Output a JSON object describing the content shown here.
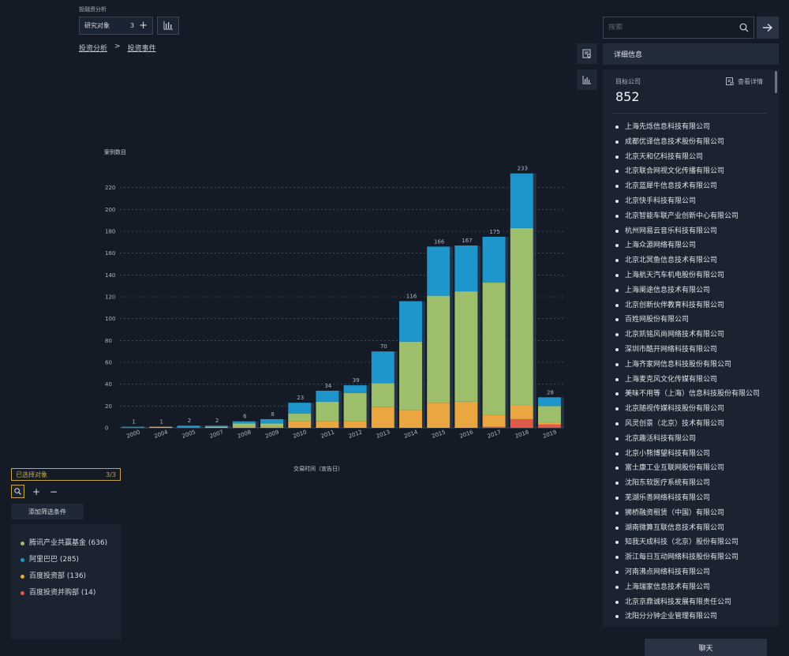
{
  "header": {
    "app_title": "投融资分析",
    "research_label": "研究对象",
    "research_count": "3",
    "plus": "+"
  },
  "breadcrumb": {
    "items": [
      "投资分析",
      "投资事件"
    ],
    "separator": ">"
  },
  "chart_data": {
    "type": "bar",
    "stacked": true,
    "ylabel": "案例数目",
    "xlabel": "交易时间（宣告日）",
    "ylim": [
      0,
      240
    ],
    "yticks": [
      0,
      20,
      40,
      60,
      80,
      100,
      120,
      140,
      160,
      180,
      200,
      220
    ],
    "grid": true,
    "categories": [
      "2000",
      "2004",
      "2005",
      "2007",
      "2008",
      "2009",
      "2010",
      "2011",
      "2012",
      "2013",
      "2014",
      "2015",
      "2016",
      "2017",
      "2018",
      "2019"
    ],
    "totals": [
      1,
      1,
      2,
      2,
      6,
      8,
      23,
      34,
      39,
      70,
      116,
      166,
      167,
      175,
      233,
      28
    ],
    "series": [
      {
        "name": "百度投资并购部",
        "color": "#e05a4a",
        "values": [
          0,
          0,
          0,
          0,
          0,
          0,
          0,
          0,
          0,
          0,
          0,
          0,
          0,
          1,
          8,
          3
        ]
      },
      {
        "name": "百度投资部",
        "color": "#eaa640",
        "values": [
          0,
          1,
          0,
          1,
          1,
          1,
          6,
          6,
          6,
          19,
          16,
          23,
          24,
          11,
          13,
          2
        ]
      },
      {
        "name": "腾讯产业共赢基金",
        "color": "#9dbe6a",
        "values": [
          0,
          0,
          0,
          0,
          3,
          3,
          7,
          18,
          26,
          22,
          63,
          98,
          101,
          121,
          162,
          15
        ]
      },
      {
        "name": "阿里巴巴",
        "color": "#1e96cc",
        "values": [
          1,
          0,
          2,
          1,
          2,
          4,
          10,
          10,
          7,
          29,
          37,
          45,
          42,
          42,
          50,
          8
        ]
      }
    ]
  },
  "selection": {
    "label": "已选择对象",
    "count": "3/3",
    "plus": "+",
    "minus": "−",
    "add_filter": "添加筛选条件"
  },
  "legend": [
    {
      "label": "腾讯产业共赢基金 (636)",
      "color": "#9dbe6a"
    },
    {
      "label": "阿里巴巴 (285)",
      "color": "#1e96cc"
    },
    {
      "label": "百度投资部 (136)",
      "color": "#eaa640"
    },
    {
      "label": "百度投资并购部 (14)",
      "color": "#e05a4a"
    }
  ],
  "search": {
    "placeholder": "搜索"
  },
  "detail": {
    "header": "详细信息",
    "target_label": "目标公司",
    "target_value": "852",
    "view_detail": "查看详情",
    "companies": [
      "上海先烁信息科技有限公司",
      "成都优译信息技术股份有限公司",
      "北京天和亿科技有限公司",
      "北京联合网视文化传播有限公司",
      "北京蓝犀牛信息技术有限公司",
      "北京快手科技有限公司",
      "北京智能车联产业创新中心有限公司",
      "杭州网易云音乐科技有限公司",
      "上海众源网络有限公司",
      "北京北冥鱼信息技术有限公司",
      "上海航天汽车机电股份有限公司",
      "上海阑途信息技术有限公司",
      "北京创新伙伴教育科技有限公司",
      "百姓网股份有限公司",
      "北京凯铭风尚网络技术有限公司",
      "深圳市酷开网络科技有限公司",
      "上海齐家网信息科技股份有限公司",
      "上海麦克风文化传媒有限公司",
      "美味不用等（上海）信息科技股份有限公司",
      "北京随视传媒科技股份有限公司",
      "风灵创景（北京）技术有限公司",
      "北京趣活科技有限公司",
      "北京小熊博望科技有限公司",
      "富士康工业互联网股份有限公司",
      "沈阳东软医疗系统有限公司",
      "芜湖乐善网络科技有限公司",
      "狮桥融资租赁（中国）有限公司",
      "湖南微算互联信息技术有限公司",
      "知我天成科技（北京）股份有限公司",
      "浙江每日互动网络科技股份有限公司",
      "河南沸点网络科技有限公司",
      "上海瑞家信息技术有限公司",
      "北京京鼎诚科技发展有限责任公司",
      "沈阳分分钟企业管理有限公司"
    ]
  },
  "chat": {
    "label": "聊天"
  },
  "icons": {
    "bar_chart": "bar-chart-icon",
    "report": "report-icon",
    "search": "search-icon",
    "arrow_right": "arrow-right-icon",
    "zoom": "zoom-icon"
  }
}
